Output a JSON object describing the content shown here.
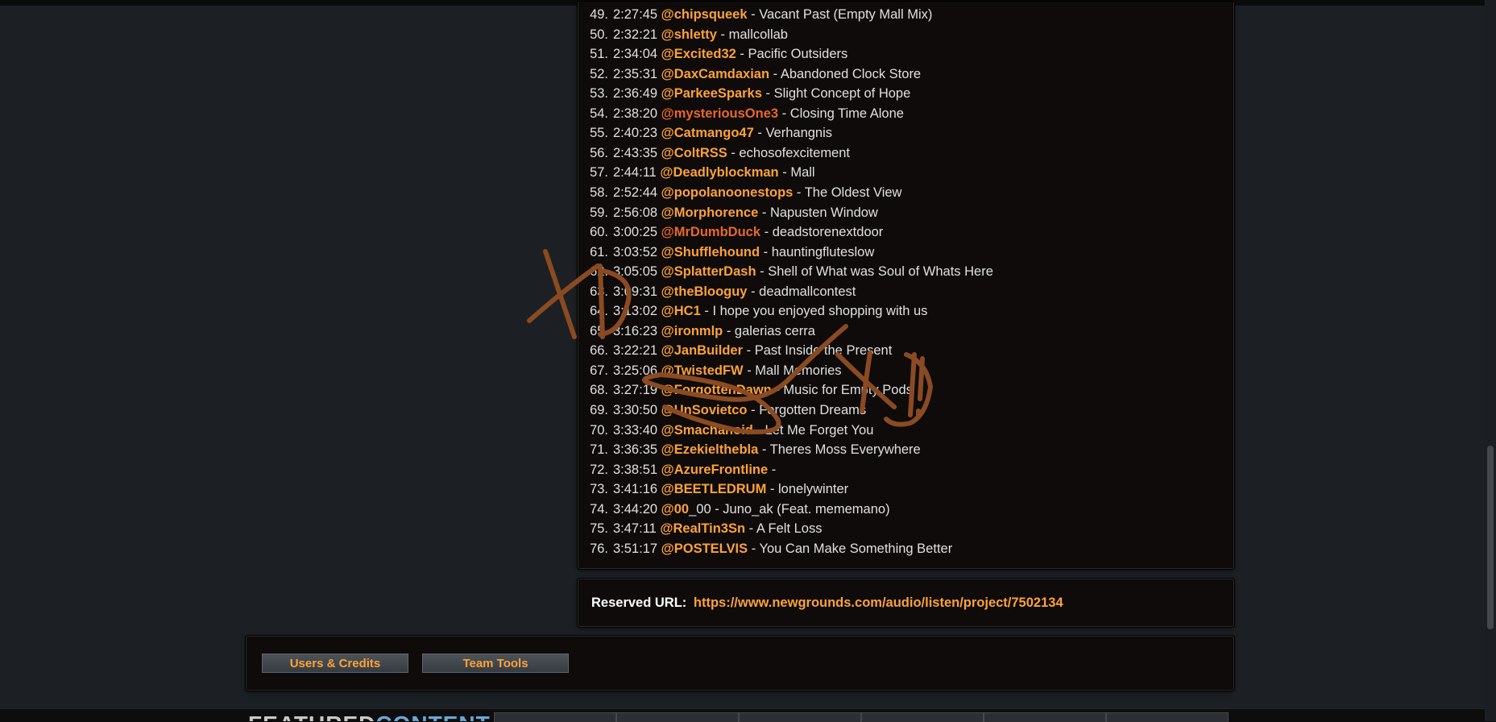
{
  "tracks": [
    {
      "num": "49.",
      "time": "2:27:45",
      "user": "@chipsqueek",
      "title": "Vacant Past (Empty Mall Mix)"
    },
    {
      "num": "50.",
      "time": "2:32:21",
      "user": "@shletty",
      "title": "mallcollab"
    },
    {
      "num": "51.",
      "time": "2:34:04",
      "user": "@Excited32",
      "title": "Pacific Outsiders"
    },
    {
      "num": "52.",
      "time": "2:35:31",
      "user": "@DaxCamdaxian",
      "title": "Abandoned Clock Store"
    },
    {
      "num": "53.",
      "time": "2:36:49",
      "user": "@ParkeeSparks",
      "title": "Slight Concept of Hope"
    },
    {
      "num": "54.",
      "time": "2:38:20",
      "user": "@mysteriousOne3",
      "title": "Closing Time Alone",
      "alt": true
    },
    {
      "num": "55.",
      "time": "2:40:23",
      "user": "@Catmango47",
      "title": "Verhangnis"
    },
    {
      "num": "56.",
      "time": "2:43:35",
      "user": "@ColtRSS",
      "title": "echosofexcitement"
    },
    {
      "num": "57.",
      "time": "2:44:11",
      "user": "@Deadlyblockman",
      "title": "Mall"
    },
    {
      "num": "58.",
      "time": "2:52:44",
      "user": "@popolanoonestops",
      "title": "The Oldest View"
    },
    {
      "num": "59.",
      "time": "2:56:08",
      "user": "@Morphorence",
      "title": "Napusten Window"
    },
    {
      "num": "60.",
      "time": "3:00:25",
      "user": "@MrDumbDuck",
      "title": "deadstorenextdoor",
      "alt": true
    },
    {
      "num": "61.",
      "time": "3:03:52",
      "user": "@Shufflehound",
      "title": "hauntingfluteslow"
    },
    {
      "num": "62.",
      "time": "3:05:05",
      "user": "@SplatterDash",
      "title": "Shell of What was Soul of Whats Here"
    },
    {
      "num": "63.",
      "time": "3:09:31",
      "user": "@theBlooguy",
      "title": "deadmallcontest"
    },
    {
      "num": "64.",
      "time": "3:13:02",
      "user": "@HC1",
      "title": "I hope you enjoyed shopping with us"
    },
    {
      "num": "65.",
      "time": "3:16:23",
      "user": "@ironmlp",
      "title": "galerias cerra"
    },
    {
      "num": "66.",
      "time": "3:22:21",
      "user": "@JanBuilder",
      "title": "Past Inside the Present"
    },
    {
      "num": "67.",
      "time": "3:25:06",
      "user": "@TwistedFW",
      "title": "Mall Memories"
    },
    {
      "num": "68.",
      "time": "3:27:19",
      "user": "@ForgottenDawn",
      "title": "Music for Empty Pods"
    },
    {
      "num": "69.",
      "time": "3:30:50",
      "user": "@UnSovietco",
      "title": "Forgotten Dreams"
    },
    {
      "num": "70.",
      "time": "3:33:40",
      "user": "@Smachanoid",
      "title": "Let Me Forget You"
    },
    {
      "num": "71.",
      "time": "3:36:35",
      "user": "@Ezekielthebla",
      "title": "Theres Moss Everywhere"
    },
    {
      "num": "72.",
      "time": "3:38:51",
      "user": "@AzureFrontline",
      "title": ""
    },
    {
      "num": "73.",
      "time": "3:41:16",
      "user": "@BEETLEDRUM",
      "title": "lonelywinter"
    },
    {
      "num": "74.",
      "time": "3:44:20",
      "user": "@00",
      "title": "_00 - Juno_ak (Feat. mememano)"
    },
    {
      "num": "75.",
      "time": "3:47:11",
      "user": "@RealTin3Sn",
      "title": "A Felt Loss"
    },
    {
      "num": "76.",
      "time": "3:51:17",
      "user": "@POSTELVIS",
      "title": "You Can Make Something Better"
    }
  ],
  "reserved": {
    "label": "Reserved URL:",
    "url": "https://www.newgrounds.com/audio/listen/project/7502134"
  },
  "tools": {
    "users_credits": "Users & Credits",
    "team_tools": "Team Tools"
  },
  "footer": {
    "featured_prefix": "FEATURED",
    "featured_accent": "CONTENT"
  },
  "scribble": {
    "text": "XD",
    "color": "#8a4a22"
  },
  "colors": {
    "accent": "#fda238",
    "alt_user": "#e8672a",
    "panel_bg": "#0e0b0a",
    "page_bg": "#1c2024"
  }
}
